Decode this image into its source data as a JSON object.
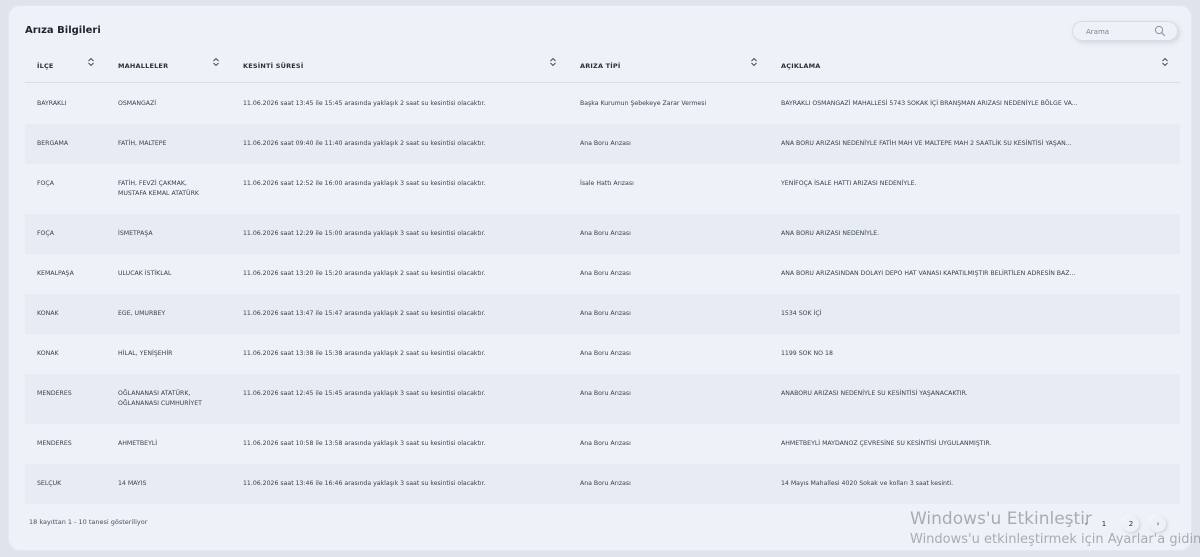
{
  "panel": {
    "title": "Arıza Bilgileri",
    "search_placeholder": "Arama"
  },
  "columns": [
    "İLÇE",
    "MAHALLELER",
    "KESİNTİ SÜRESİ",
    "ARIZA TİPİ",
    "AÇIKLAMA"
  ],
  "rows": [
    {
      "ilce": "BAYRAKLI",
      "mah1": "OSMANGAZİ",
      "mah2": "",
      "sure": "11.06.2026 saat 13:45 ile 15:45 arasında yaklaşık 2 saat su kesintisi olacaktır.",
      "tip": "Başka Kurumun Şebekeye Zarar Vermesi",
      "aciklama": "BAYRAKLI OSMANGAZİ MAHALLESİ 5743 SOKAK İÇİ BRANŞMAN ARIZASI NEDENİYLE BÖLGE VA..."
    },
    {
      "ilce": "BERGAMA",
      "mah1": "FATİH, MALTEPE",
      "mah2": "",
      "sure": "11.06.2026 saat 09:40 ile 11:40 arasında yaklaşık 2 saat su kesintisi olacaktır.",
      "tip": "Ana Boru Arızası",
      "aciklama": "ANA BORU ARIZASI NEDENİYLE FATİH MAH VE MALTEPE MAH 2 SAATLİK SU KESİNTİSİ YAŞAN..."
    },
    {
      "ilce": "FOÇA",
      "mah1": "FATİH, FEVZİ ÇAKMAK,",
      "mah2": "MUSTAFA KEMAL ATATÜRK",
      "sure": "11.06.2026 saat 12:52 ile 16:00 arasında yaklaşık 3 saat su kesintisi olacaktır.",
      "tip": "İsale Hattı Arızası",
      "aciklama": "YENİFOÇA İSALE HATTI ARIZASI NEDENİYLE."
    },
    {
      "ilce": "FOÇA",
      "mah1": "İSMETPAŞA",
      "mah2": "",
      "sure": "11.06.2026 saat 12:29 ile 15:00 arasında yaklaşık 3 saat su kesintisi olacaktır.",
      "tip": "Ana Boru Arızası",
      "aciklama": "ANA BORU ARIZASI NEDENİYLE."
    },
    {
      "ilce": "KEMALPAŞA",
      "mah1": "ULUCAK İSTİKLAL",
      "mah2": "",
      "sure": "11.06.2026 saat 13:20 ile 15:20 arasında yaklaşık 2 saat su kesintisi olacaktır.",
      "tip": "Ana Boru Arızası",
      "aciklama": "ANA BORU ARIZASINDAN DOLAYI DEPO HAT VANASI KAPATILMIŞTIR BELİRTİLEN ADRESİN BAZ..."
    },
    {
      "ilce": "KONAK",
      "mah1": "EGE, UMURBEY",
      "mah2": "",
      "sure": "11.06.2026 saat 13:47 ile 15:47 arasında yaklaşık 2 saat su kesintisi olacaktır.",
      "tip": "Ana Boru Arızası",
      "aciklama": "1534 SOK İÇİ"
    },
    {
      "ilce": "KONAK",
      "mah1": "HİLAL, YENİŞEHİR",
      "mah2": "",
      "sure": "11.06.2026 saat 13:38 ile 15:38 arasında yaklaşık 2 saat su kesintisi olacaktır.",
      "tip": "Ana Boru Arızası",
      "aciklama": "1199 SOK NO 18"
    },
    {
      "ilce": "MENDERES",
      "mah1": "OĞLANANASI ATATÜRK,",
      "mah2": "OĞLANANASI CUMHURİYET",
      "sure": "11.06.2026 saat 12:45 ile 15:45 arasında yaklaşık 3 saat su kesintisi olacaktır.",
      "tip": "Ana Boru Arızası",
      "aciklama": "ANABORU ARIZASI NEDENİYLE SU KESİNTİSİ YAŞANACAKTIR."
    },
    {
      "ilce": "MENDERES",
      "mah1": "AHMETBEYLİ",
      "mah2": "",
      "sure": "11.06.2026 saat 10:58 ile 13:58 arasında yaklaşık 3 saat su kesintisi olacaktır.",
      "tip": "Ana Boru Arızası",
      "aciklama": "AHMETBEYLİ MAYDANOZ ÇEVRESİNE SU KESİNTİSİ UYGULANMIŞTIR."
    },
    {
      "ilce": "SELÇUK",
      "mah1": "14 MAYIS",
      "mah2": "",
      "sure": "11.06.2026 saat 13:46 ile 16:46 arasında yaklaşık 3 saat su kesintisi olacaktır.",
      "tip": "Ana Boru Arızası",
      "aciklama": "14 Mayıs Mahallesi 4020 Sokak ve kolları 3 saat kesinti."
    }
  ],
  "footer": {
    "info": "18 kayıttan 1 - 10 tanesi gösteriliyor",
    "pages": [
      "1",
      "2"
    ],
    "next": "›",
    "prev": "‹"
  },
  "watermark": {
    "line1": "Windows'u Etkinleştir",
    "line2": "Windows'u etkinleştirmek için Ayarlar'a gidin."
  }
}
